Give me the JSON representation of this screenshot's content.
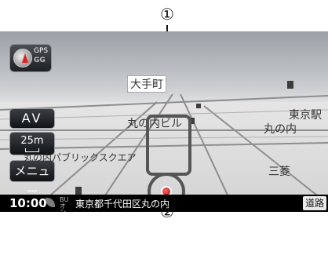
{
  "callouts": {
    "top": "①",
    "bottom": "②"
  },
  "gps_button": {
    "title": "GPS",
    "subtitle": "GG"
  },
  "side_buttons": {
    "av": "AV",
    "scale": "25m",
    "menu": "メニュー"
  },
  "map_labels": {
    "otemachi": "大手町",
    "marunouchi_building": "丸の内ビル",
    "tokyo_station": "東京駅",
    "marunouchi": "丸の内",
    "plaza": "丸の内パブリックスクエア",
    "mitsubishi": "三菱"
  },
  "status_bar": {
    "time": "10:00",
    "vics": "BU オン",
    "address": "東京都千代田区丸の内",
    "road_button": "道路"
  }
}
